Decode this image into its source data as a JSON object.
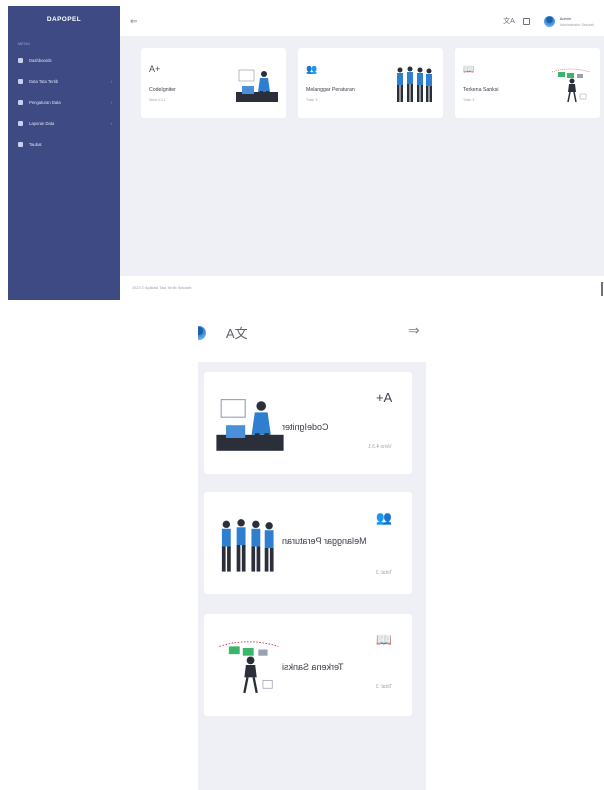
{
  "desktop": {
    "brand": "DAPOPEL",
    "menu_header": "MENU",
    "nav": [
      {
        "label": "Dashboards",
        "chevron": ""
      },
      {
        "label": "Data Tata Tertib",
        "chevron": "›"
      },
      {
        "label": "Pengaturan Data",
        "chevron": "›"
      },
      {
        "label": "Laporan Data",
        "chevron": "›"
      },
      {
        "label": "Taubat",
        "chevron": ""
      }
    ],
    "topbar": {
      "back_icon": "⇐",
      "translate_icon": "文A",
      "user_name": "Admin",
      "user_role": "Administrator Sekolah"
    },
    "cards": [
      {
        "icon": "A+",
        "title": "CodeIgniter",
        "subtitle": "Versi 4.3.1"
      },
      {
        "icon": "👥",
        "title": "Melanggar Peraturan",
        "subtitle": "Total: 3"
      },
      {
        "icon": "📖",
        "title": "Terkena Sanksi",
        "subtitle": "Total: 3"
      }
    ],
    "footer": "2023 © Aplikasi Tata Tertib Sekolah"
  },
  "mobile": {
    "translate_icon": "文A",
    "back_icon": "⇐",
    "cards": [
      {
        "icon": "A+",
        "title": "CodeIgniter",
        "subtitle": "Versi 4.3.1"
      },
      {
        "icon": "👥",
        "title": "Melanggar Peraturan",
        "subtitle": "Total: 3"
      },
      {
        "icon": "📖",
        "title": "Terkena Sanksi",
        "subtitle": "Total: 3"
      }
    ]
  },
  "colors": {
    "sidebar": "#3d4a84",
    "background": "#eef0f5",
    "accent": "#2e86de"
  }
}
